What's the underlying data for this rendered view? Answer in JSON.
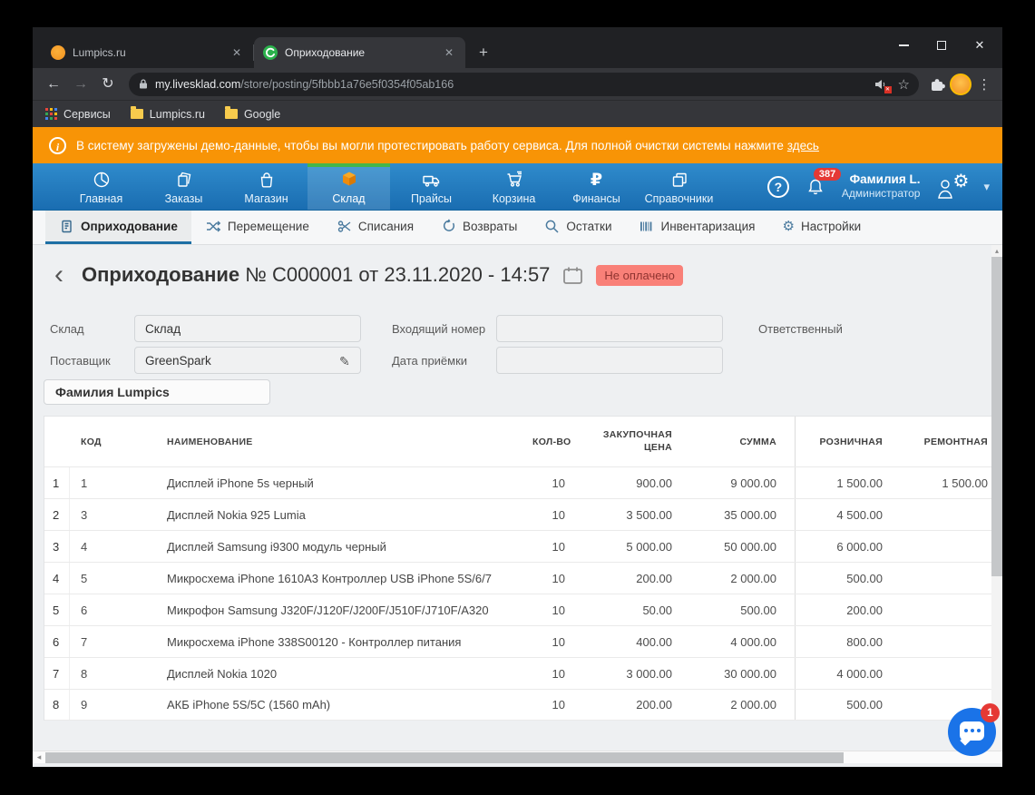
{
  "icons": {
    "back": "←",
    "forward": "→",
    "reload": "↻",
    "star": "☆",
    "menu_dots": "⋮",
    "close": "✕",
    "minimize": "–",
    "plus": "+",
    "back_chevron": "‹",
    "chevron_down": "▾",
    "question_mark": "?",
    "ruble": "₽",
    "gear": "⚙",
    "pencil": "✎",
    "info": "i",
    "up_arrow": "▴",
    "left_arrow": "◂"
  },
  "browser": {
    "tabs": [
      {
        "title": "Lumpics.ru"
      },
      {
        "title": "Оприходование"
      }
    ],
    "url": {
      "domain": "my.livesklad.com",
      "path": "/store/posting/5fbbb1a76e5f0354f05ab166"
    },
    "bookmarks": {
      "services": "Сервисы",
      "lumpics": "Lumpics.ru",
      "google": "Google"
    }
  },
  "banner": {
    "text": "В систему загружены демо-данные, чтобы вы могли протестировать работу сервиса. Для полной очистки системы нажмите",
    "link_text": "здесь"
  },
  "main_nav": {
    "items": [
      {
        "label": "Главная",
        "icon": "pie-chart"
      },
      {
        "label": "Заказы",
        "icon": "documents-stack"
      },
      {
        "label": "Магазин",
        "icon": "shopping-bag"
      },
      {
        "label": "Склад",
        "icon": "orange-cube",
        "active": true
      },
      {
        "label": "Прайсы",
        "icon": "truck"
      },
      {
        "label": "Корзина",
        "icon": "shopping-cart"
      },
      {
        "label": "Финансы",
        "icon": "ruble-sign"
      },
      {
        "label": "Справочники",
        "icon": "layered-pages"
      }
    ],
    "notifications_count": "387",
    "user_name": "Фамилия L.",
    "user_role": "Администратор"
  },
  "sub_nav": {
    "items": [
      {
        "label": "Оприходование",
        "icon": "document",
        "active": true
      },
      {
        "label": "Перемещение",
        "icon": "shuffle-arrows"
      },
      {
        "label": "Списания",
        "icon": "scissors"
      },
      {
        "label": "Возвраты",
        "icon": "return-arrow"
      },
      {
        "label": "Остатки",
        "icon": "magnifier"
      },
      {
        "label": "Инвентаризация",
        "icon": "barcode"
      },
      {
        "label": "Настройки",
        "icon": "gear"
      }
    ]
  },
  "page": {
    "title": {
      "name": "Оприходование",
      "document_number": "№ С000001",
      "date_text": "от 23.11.2020 - 14:57",
      "status_badge": "Не оплачено"
    },
    "form": {
      "warehouse_label": "Склад",
      "warehouse_value": "Склад",
      "supplier_label": "Поставщик",
      "supplier_value": "GreenSpark",
      "incoming_number_label": "Входящий номер",
      "incoming_number_value": "",
      "acceptance_date_label": "Дата приёмки",
      "acceptance_date_value": "",
      "responsible_label": "Ответственный",
      "employee_tag": "Фамилия Lumpics"
    },
    "table": {
      "headers": {
        "code": "КОД",
        "name": "НАИМЕНОВАНИЕ",
        "qty": "КОЛ-ВО",
        "purchase_price": "ЗАКУПОЧНАЯ ЦЕНА",
        "sum": "СУММА",
        "retail": "РОЗНИЧНАЯ",
        "repair": "РЕМОНТНАЯ"
      },
      "rows": [
        {
          "n": "1",
          "code": "1",
          "name": "Дисплей iPhone 5s черный",
          "qty": "10",
          "price": "900.00",
          "sum": "9 000.00",
          "retail": "1 500.00",
          "repair": "1 500.00"
        },
        {
          "n": "2",
          "code": "3",
          "name": "Дисплей Nokia 925 Lumia",
          "qty": "10",
          "price": "3 500.00",
          "sum": "35 000.00",
          "retail": "4 500.00",
          "repair": ""
        },
        {
          "n": "3",
          "code": "4",
          "name": "Дисплей Samsung i9300 модуль черный",
          "qty": "10",
          "price": "5 000.00",
          "sum": "50 000.00",
          "retail": "6 000.00",
          "repair": ""
        },
        {
          "n": "4",
          "code": "5",
          "name": "Микросхема iPhone 1610A3 Контроллер USB iPhone 5S/6/7",
          "qty": "10",
          "price": "200.00",
          "sum": "2 000.00",
          "retail": "500.00",
          "repair": ""
        },
        {
          "n": "5",
          "code": "6",
          "name": "Микрофон Samsung J320F/J120F/J200F/J510F/J710F/A320",
          "qty": "10",
          "price": "50.00",
          "sum": "500.00",
          "retail": "200.00",
          "repair": ""
        },
        {
          "n": "6",
          "code": "7",
          "name": "Микросхема iPhone 338S00120 - Контроллер питания",
          "qty": "10",
          "price": "400.00",
          "sum": "4 000.00",
          "retail": "800.00",
          "repair": ""
        },
        {
          "n": "7",
          "code": "8",
          "name": "Дисплей Nokia 1020",
          "qty": "10",
          "price": "3 000.00",
          "sum": "30 000.00",
          "retail": "4 000.00",
          "repair": ""
        },
        {
          "n": "8",
          "code": "9",
          "name": "АКБ iPhone 5S/5C (1560 mAh)",
          "qty": "10",
          "price": "200.00",
          "sum": "2 000.00",
          "retail": "500.00",
          "repair": ""
        }
      ]
    }
  },
  "chat": {
    "unread_count": "1"
  },
  "colors": {
    "nav_blue": "#1f78bf",
    "banner_orange": "#f89406",
    "active_green": "#45b649",
    "status_bg": "#f98078",
    "status_text": "#8f3330",
    "badge_red": "#e53935",
    "chat_blue": "#1a73e8"
  }
}
